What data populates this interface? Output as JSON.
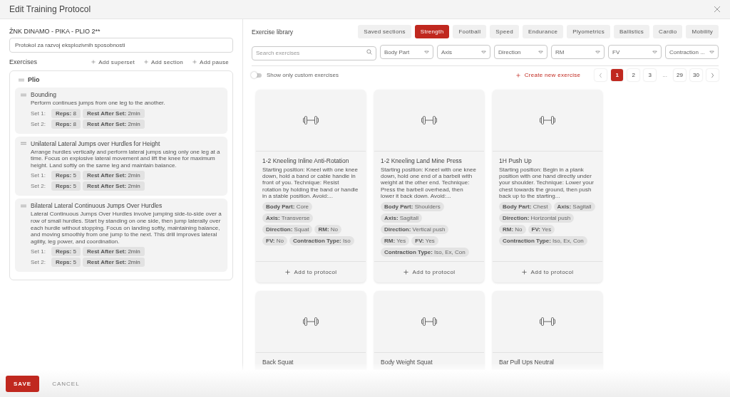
{
  "dialog": {
    "title": "Edit Training Protocol"
  },
  "protocol": {
    "name": "ŽNK DINAMO - PIKA - PLIO 2**",
    "description": "Protokol za razvoj eksplozivnih sposobnosti"
  },
  "exercises_header": {
    "label": "Exercises",
    "actions": [
      "Add superset",
      "Add section",
      "Add pause"
    ]
  },
  "sections": [
    {
      "name": "Plio",
      "exercises": [
        {
          "name": "Bounding",
          "description": "Perform continues jumps from one leg to the another.",
          "sets": [
            {
              "label": "Set 1:",
              "reps_label": "Reps:",
              "reps": "8",
              "rest_label": "Rest After Set:",
              "rest": "2min"
            },
            {
              "label": "Set 2:",
              "reps_label": "Reps:",
              "reps": "8",
              "rest_label": "Rest After Set:",
              "rest": "2min"
            }
          ]
        },
        {
          "name": "Unilateral Lateral Jumps over Hurdles for Height",
          "description": "Arrange hurdles vertically and perform lateral jumps using only one leg at a time. Focus on explosive lateral movement and lift the knee for maximum height. Land softly on the same leg and maintain balance.",
          "sets": [
            {
              "label": "Set 1:",
              "reps_label": "Reps:",
              "reps": "5",
              "rest_label": "Rest After Set:",
              "rest": "2min"
            },
            {
              "label": "Set 2:",
              "reps_label": "Reps:",
              "reps": "5",
              "rest_label": "Rest After Set:",
              "rest": "2min"
            }
          ]
        },
        {
          "name": "Bilateral Lateral Continuous Jumps Over Hurdles",
          "description": "Lateral Continuous Jumps Over Hurdles involve jumping side-to-side over a row of small hurdles. Start by standing on one side, then jump laterally over each hurdle without stopping. Focus on landing softly, maintaining balance, and moving smoothly from one jump to the next. This drill improves lateral agility, leg power, and coordination.",
          "sets": [
            {
              "label": "Set 1:",
              "reps_label": "Reps:",
              "reps": "5",
              "rest_label": "Rest After Set:",
              "rest": "2min"
            },
            {
              "label": "Set 2:",
              "reps_label": "Reps:",
              "reps": "5",
              "rest_label": "Rest After Set:",
              "rest": "2min"
            }
          ]
        }
      ]
    }
  ],
  "library": {
    "title": "Exercise library",
    "tabs": [
      {
        "label": "Saved sections",
        "selected": false
      },
      {
        "label": "Strength",
        "selected": true
      },
      {
        "label": "Football",
        "selected": false
      },
      {
        "label": "Speed",
        "selected": false
      },
      {
        "label": "Endurance",
        "selected": false
      },
      {
        "label": "Plyometrics",
        "selected": false
      },
      {
        "label": "Ballistics",
        "selected": false
      },
      {
        "label": "Cardio",
        "selected": false
      },
      {
        "label": "Mobility",
        "selected": false
      }
    ],
    "search": {
      "placeholder": "Search exercises"
    },
    "filters": [
      "Body Part",
      "Axis",
      "Direction",
      "RM",
      "FV",
      "Contraction ..."
    ],
    "custom_toggle": {
      "label": "Show only custom exercises",
      "on": false
    },
    "create_label": "Create new exercise",
    "pages": [
      {
        "label": "1",
        "selected": true
      },
      {
        "label": "2",
        "selected": false
      },
      {
        "label": "3",
        "selected": false
      },
      {
        "label": "...",
        "kind": "gap"
      },
      {
        "label": "29",
        "selected": false
      },
      {
        "label": "30",
        "selected": false
      }
    ],
    "cards": [
      {
        "title": "1-2 Kneeling Inline Anti-Rotation",
        "description": "Starting position: Kneel with one knee down, hold a band or cable handle in front of you. Technique: Resist rotation by holding the band or handle in a stable position. Avoid:...",
        "tags": [
          {
            "label": "Body Part:",
            "value": "Core"
          },
          {
            "label": "Axis:",
            "value": "Transverse"
          },
          {
            "label": "Direction:",
            "value": "Squat"
          },
          {
            "label": "RM:",
            "value": "No"
          },
          {
            "label": "FV:",
            "value": "No"
          },
          {
            "label": "Contraction Type:",
            "value": "Iso"
          }
        ],
        "action": "Add to protocol"
      },
      {
        "title": "1-2 Kneeling Land Mine Press",
        "description": "Starting position: Kneel with one knee down, hold one end of a barbell with weight at the other end. Technique: Press the barbell overhead, then lower it back down. Avoid:...",
        "tags": [
          {
            "label": "Body Part:",
            "value": "Shoulders"
          },
          {
            "label": "Axis:",
            "value": "Sagitall"
          },
          {
            "label": "Direction:",
            "value": "Vertical push"
          },
          {
            "label": "RM:",
            "value": "Yes"
          },
          {
            "label": "FV:",
            "value": "Yes"
          },
          {
            "label": "Contraction Type:",
            "value": "Iso, Ex, Con"
          }
        ],
        "action": "Add to protocol"
      },
      {
        "title": "1H Push Up",
        "description": "Starting position: Begin in a plank position with one hand directly under your shoulder. Technique: Lower your chest towards the ground, then push back up to the starting...",
        "tags": [
          {
            "label": "Body Part:",
            "value": "Chest"
          },
          {
            "label": "Axis:",
            "value": "Sagitall"
          },
          {
            "label": "Direction:",
            "value": "Horizontal push"
          },
          {
            "label": "RM:",
            "value": "No"
          },
          {
            "label": "FV:",
            "value": "Yes"
          },
          {
            "label": "Contraction Type:",
            "value": "Iso, Ex, Con"
          }
        ],
        "action": "Add to protocol"
      },
      {
        "title": "Back Squat"
      },
      {
        "title": "Body Weight Squat"
      },
      {
        "title": "Bar Pull Ups Neutral"
      }
    ]
  },
  "footer": {
    "save": "SAVE",
    "cancel": "CANCEL"
  }
}
